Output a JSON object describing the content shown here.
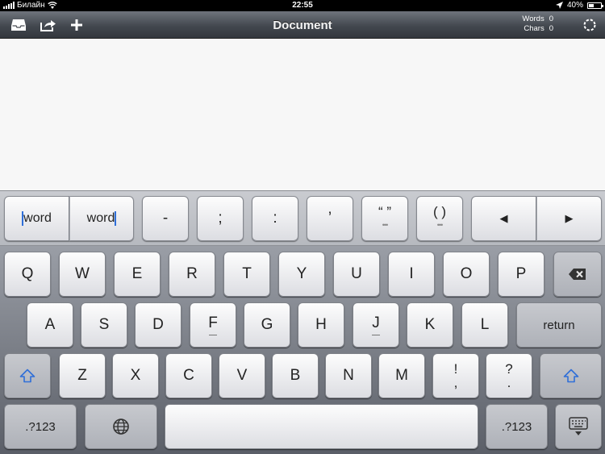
{
  "status_bar": {
    "carrier": "Билайн",
    "time": "22:55",
    "battery": "40%",
    "battery_level": 0.4
  },
  "toolbar": {
    "title": "Document",
    "words_label": "Words",
    "words_value": "0",
    "chars_label": "Chars",
    "chars_value": "0",
    "icons": [
      "inbox-icon",
      "share-icon",
      "plus-icon",
      "settings-icon"
    ]
  },
  "accessory": {
    "word_left": "word",
    "word_right": "word",
    "keys": [
      "-",
      ";",
      ":",
      "’"
    ],
    "quote_key": "“ ”",
    "paren_key": "( )",
    "arrow_left": "◀",
    "arrow_right": "▶"
  },
  "keyboard": {
    "row1": [
      "Q",
      "W",
      "E",
      "R",
      "T",
      "Y",
      "U",
      "I",
      "O",
      "P"
    ],
    "row2": [
      "A",
      "S",
      "D",
      "F",
      "G",
      "H",
      "J",
      "K",
      "L"
    ],
    "row3": [
      "Z",
      "X",
      "C",
      "V",
      "B",
      "N",
      "M"
    ],
    "return": "return",
    "numbers_left": ".?123",
    "numbers_right": ".?123",
    "punct1_top": "!",
    "punct1_bottom": ",",
    "punct2_top": "?",
    "punct2_bottom": "."
  },
  "colors": {
    "cursor": "#2f6fd8",
    "shift_arrow": "#2f6fd8"
  }
}
